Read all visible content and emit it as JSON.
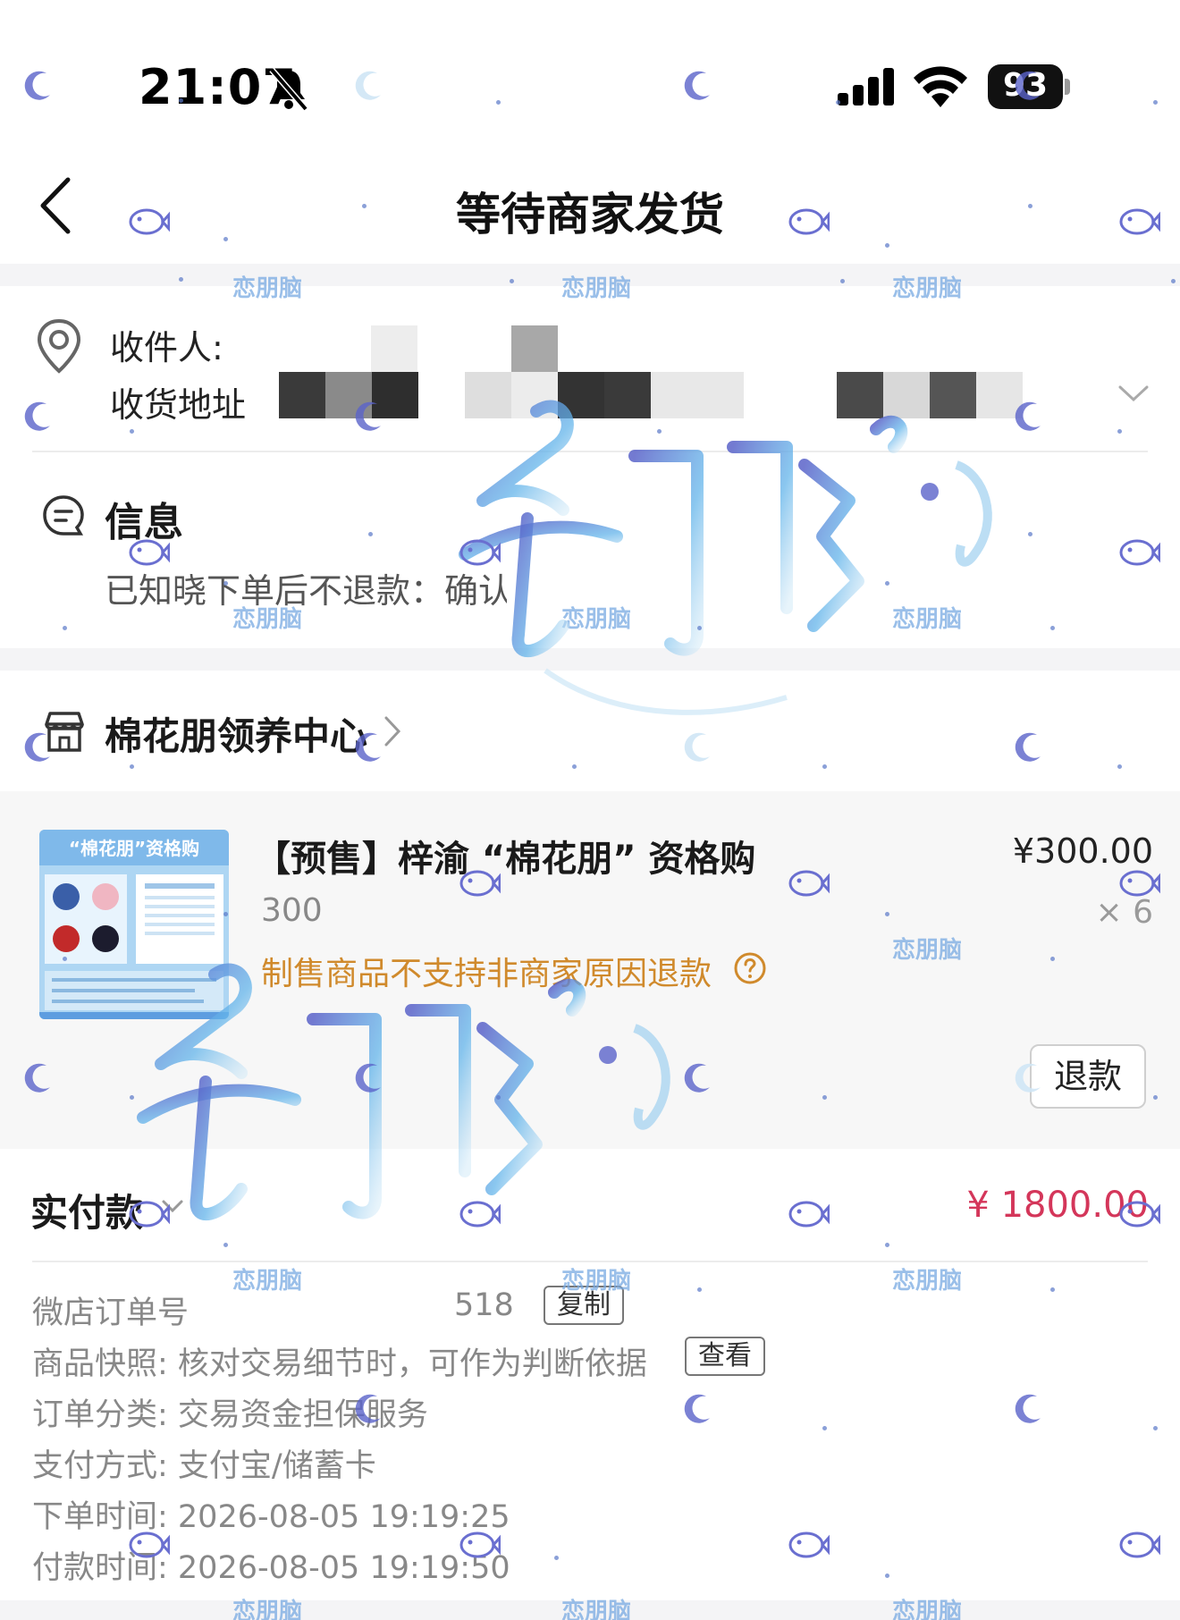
{
  "status_bar": {
    "time": "21:07",
    "battery_level": "93",
    "icons": [
      "mute-bell-icon",
      "cellular-signal-icon",
      "wifi-icon",
      "battery-icon"
    ]
  },
  "nav": {
    "title": "等待商家发货",
    "back_icon": "chevron-left-icon"
  },
  "address": {
    "recipient_label": "收件人:",
    "address_label": "收货地址",
    "icon": "location-pin-icon"
  },
  "info": {
    "title": "信息",
    "text": "已知晓下单后不退款：确认",
    "icon": "message-icon"
  },
  "shop": {
    "name": "棉花朋领养中心",
    "icon": "store-icon"
  },
  "product": {
    "title": "【预售】梓渝 “棉花朋” 资格购",
    "spec": "300",
    "notice": "制售商品不支持非商家原因退款",
    "price": "¥300.00",
    "quantity": "× 6",
    "refund_label": "退款",
    "thumb_title": "“棉花朋”资格购"
  },
  "payment": {
    "paid_label": "实付款",
    "paid_amount": "¥ 1800.00",
    "order_no_label": "微店订单号",
    "order_no_partial": "518",
    "copy_label": "复制",
    "snapshot_text": "商品快照: 核对交易细节时，可作为判断依据",
    "view_label": "查看",
    "category_text": "订单分类:  交易资金担保服务",
    "payment_method_text": "支付方式:  支付宝/储蓄卡",
    "order_time_text": "下单时间:  2026-08-05 19:19:25",
    "pay_time_text": "付款时间:  2026-08-05 19:19:50"
  },
  "watermark": {
    "small_text": "恋朋脑",
    "accent": "#6a6fd0"
  },
  "colors": {
    "price_red": "#d4365a",
    "notice_orange": "#d08a2c",
    "band_gray": "#f4f4f6"
  }
}
